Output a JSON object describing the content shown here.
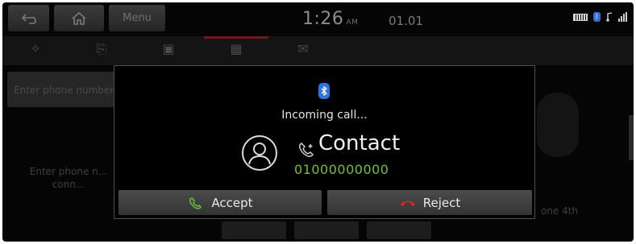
{
  "topbar": {
    "back_icon": "back-arrow-icon",
    "home_icon": "home-icon",
    "menu_label": "Menu",
    "time": "1:26",
    "ampm": "AM",
    "date": "01.01",
    "status_icons": [
      "battery-icon",
      "bluetooth-icon",
      "signal-icon"
    ]
  },
  "background": {
    "tabs": [
      "favorites-icon",
      "call-history-icon",
      "contacts-icon",
      "dial-pad-icon",
      "messages-icon"
    ],
    "input_placeholder": "Enter phone number",
    "hint_text": "Enter phone n... conn...",
    "right_hint": "one 4th"
  },
  "popup": {
    "bluetooth_icon": "bluetooth-icon",
    "status": "Incoming call...",
    "avatar_icon": "person-avatar-icon",
    "caller_icon": "incoming-call-icon",
    "contact_name": "Contact",
    "contact_number": "01000000000",
    "accept_label": "Accept",
    "reject_label": "Reject"
  },
  "colors": {
    "accept_icon": "#5fbf3a",
    "reject_icon": "#d12b2b",
    "number": "#6cc236",
    "bluetooth": "#2f73de"
  }
}
